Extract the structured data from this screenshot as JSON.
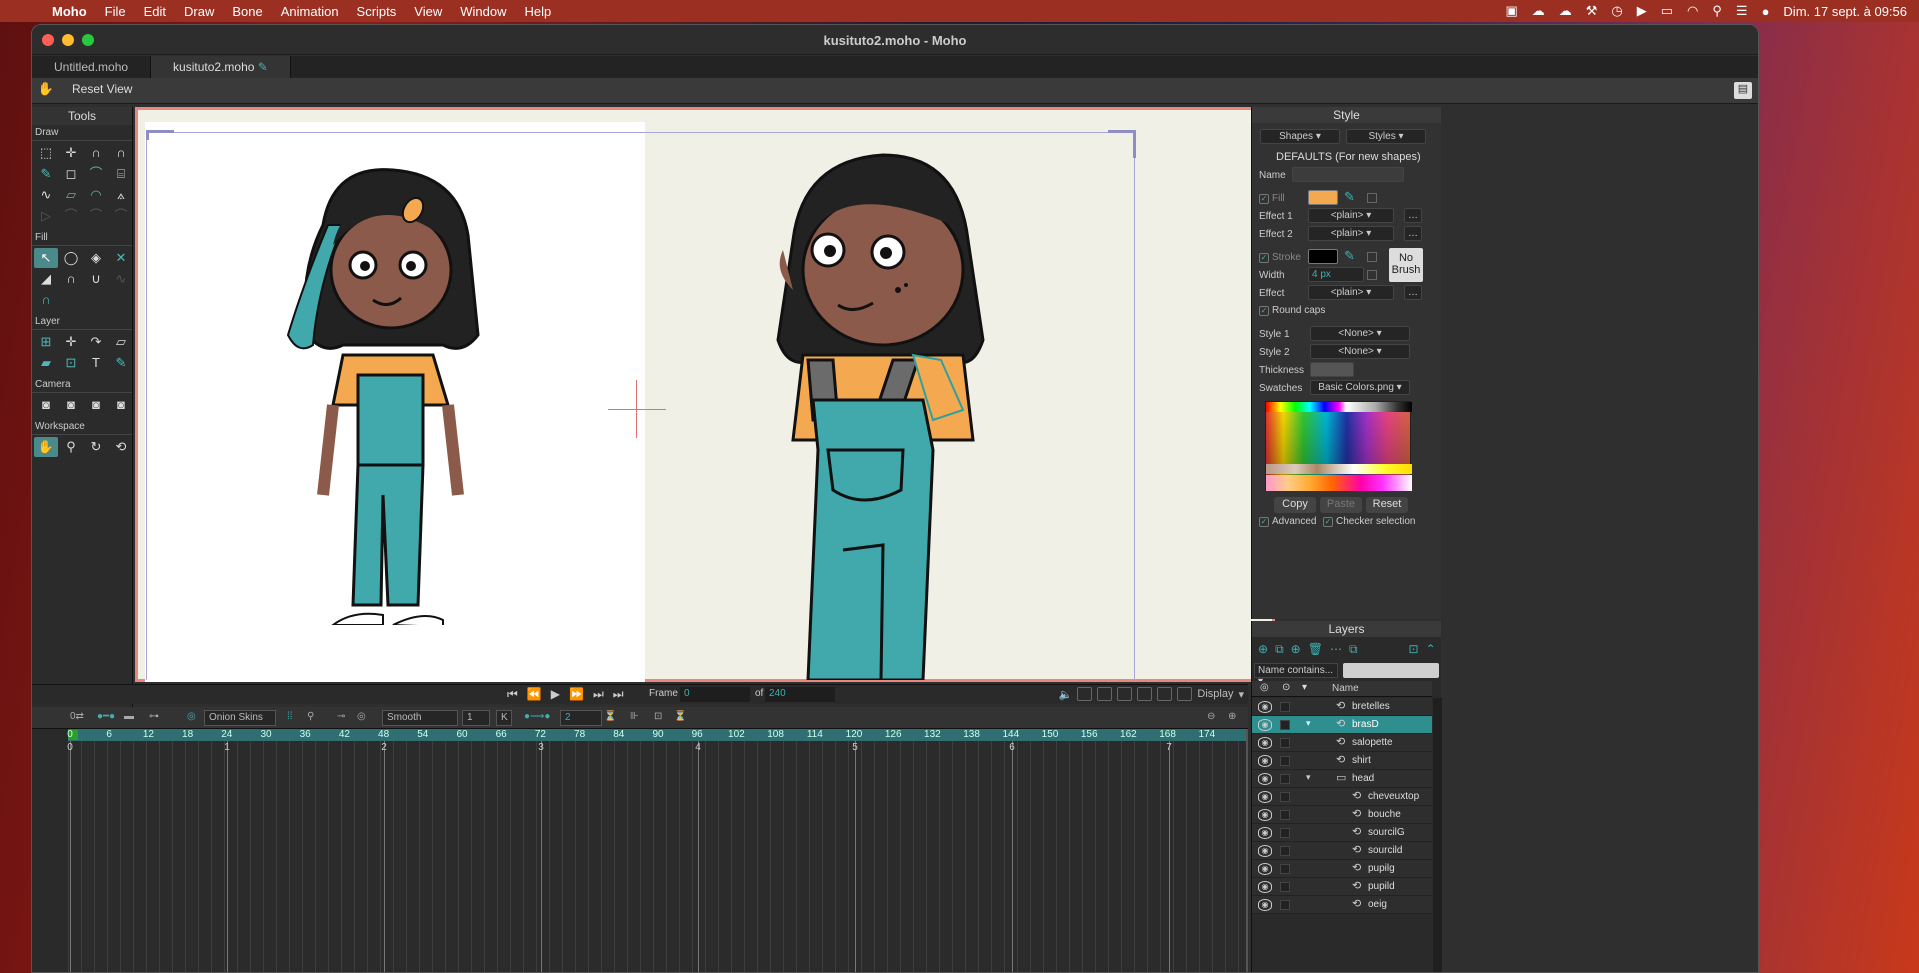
{
  "menubar": {
    "items": [
      "Moho",
      "File",
      "Edit",
      "Draw",
      "Bone",
      "Animation",
      "Scripts",
      "View",
      "Window",
      "Help"
    ],
    "datetime": "Dim. 17 sept. à 09:56"
  },
  "window": {
    "title": "kusituto2.moho - Moho"
  },
  "tabs": [
    "Untitled.moho",
    "kusituto2.moho"
  ],
  "toolbar": {
    "reset_view": "Reset View"
  },
  "tools": {
    "title": "Tools",
    "sections": [
      "Draw",
      "Fill",
      "Layer",
      "Camera",
      "Workspace"
    ]
  },
  "transport": {
    "frame_label": "Frame",
    "frame_value": "0",
    "of_label": "of",
    "total_frames": "240",
    "display_label": "Display"
  },
  "timeline_bar": {
    "onion_skins": "Onion Skins",
    "interp": "Smooth",
    "step": "1",
    "k_label": "K",
    "keys": "2"
  },
  "ruler": [
    "0",
    "6",
    "12",
    "18",
    "24",
    "30",
    "36",
    "42",
    "48",
    "54",
    "60",
    "66",
    "72",
    "78",
    "84",
    "90",
    "96",
    "102",
    "108",
    "114",
    "120",
    "126",
    "132",
    "138",
    "144",
    "150",
    "156",
    "162",
    "168",
    "174"
  ],
  "seconds": [
    "0",
    "1",
    "2",
    "3",
    "4",
    "5",
    "6",
    "7"
  ],
  "style_panel": {
    "title": "Style",
    "shapes_dd": "Shapes",
    "styles_dd": "Styles",
    "defaults": "DEFAULTS (For new shapes)",
    "name_label": "Name",
    "fill_label": "Fill",
    "fill_color": "#f4a950",
    "effect1_label": "Effect 1",
    "effect1": "<plain>",
    "effect2_label": "Effect 2",
    "effect2": "<plain>",
    "stroke_label": "Stroke",
    "stroke_color": "#000000",
    "no_brush": "No Brush",
    "width_label": "Width",
    "width_value": "4 px",
    "effect_label": "Effect",
    "effect": "<plain>",
    "round_caps": "Round caps",
    "style1_label": "Style 1",
    "style1": "<None>",
    "style2_label": "Style 2",
    "style2": "<None>",
    "thickness_label": "Thickness",
    "swatches_label": "Swatches",
    "swatches": "Basic Colors.png",
    "copy": "Copy",
    "paste": "Paste",
    "reset": "Reset",
    "advanced": "Advanced",
    "checker": "Checker selection"
  },
  "layers_panel": {
    "title": "Layers",
    "filter": "Name contains...",
    "name_header": "Name",
    "rows": [
      {
        "name": "bretelles",
        "indent": 0,
        "selected": false,
        "type": "vector"
      },
      {
        "name": "brasD",
        "indent": 0,
        "selected": true,
        "type": "vector"
      },
      {
        "name": "salopette",
        "indent": 0,
        "selected": false,
        "type": "vector"
      },
      {
        "name": "shirt",
        "indent": 0,
        "selected": false,
        "type": "vector"
      },
      {
        "name": "head",
        "indent": 0,
        "selected": false,
        "type": "group"
      },
      {
        "name": "cheveuxtop",
        "indent": 1,
        "selected": false,
        "type": "vector"
      },
      {
        "name": "bouche",
        "indent": 1,
        "selected": false,
        "type": "vector"
      },
      {
        "name": "sourcilG",
        "indent": 1,
        "selected": false,
        "type": "vector"
      },
      {
        "name": "sourcild",
        "indent": 1,
        "selected": false,
        "type": "vector"
      },
      {
        "name": "pupilg",
        "indent": 1,
        "selected": false,
        "type": "vector"
      },
      {
        "name": "pupild",
        "indent": 1,
        "selected": false,
        "type": "vector"
      },
      {
        "name": "oeig",
        "indent": 1,
        "selected": false,
        "type": "vector"
      }
    ]
  },
  "colors": {
    "accent": "#3fb0b0",
    "skin": "#8c5a4a",
    "hair": "#222222",
    "overalls": "#41a8ab",
    "shirt": "#f4a950"
  }
}
